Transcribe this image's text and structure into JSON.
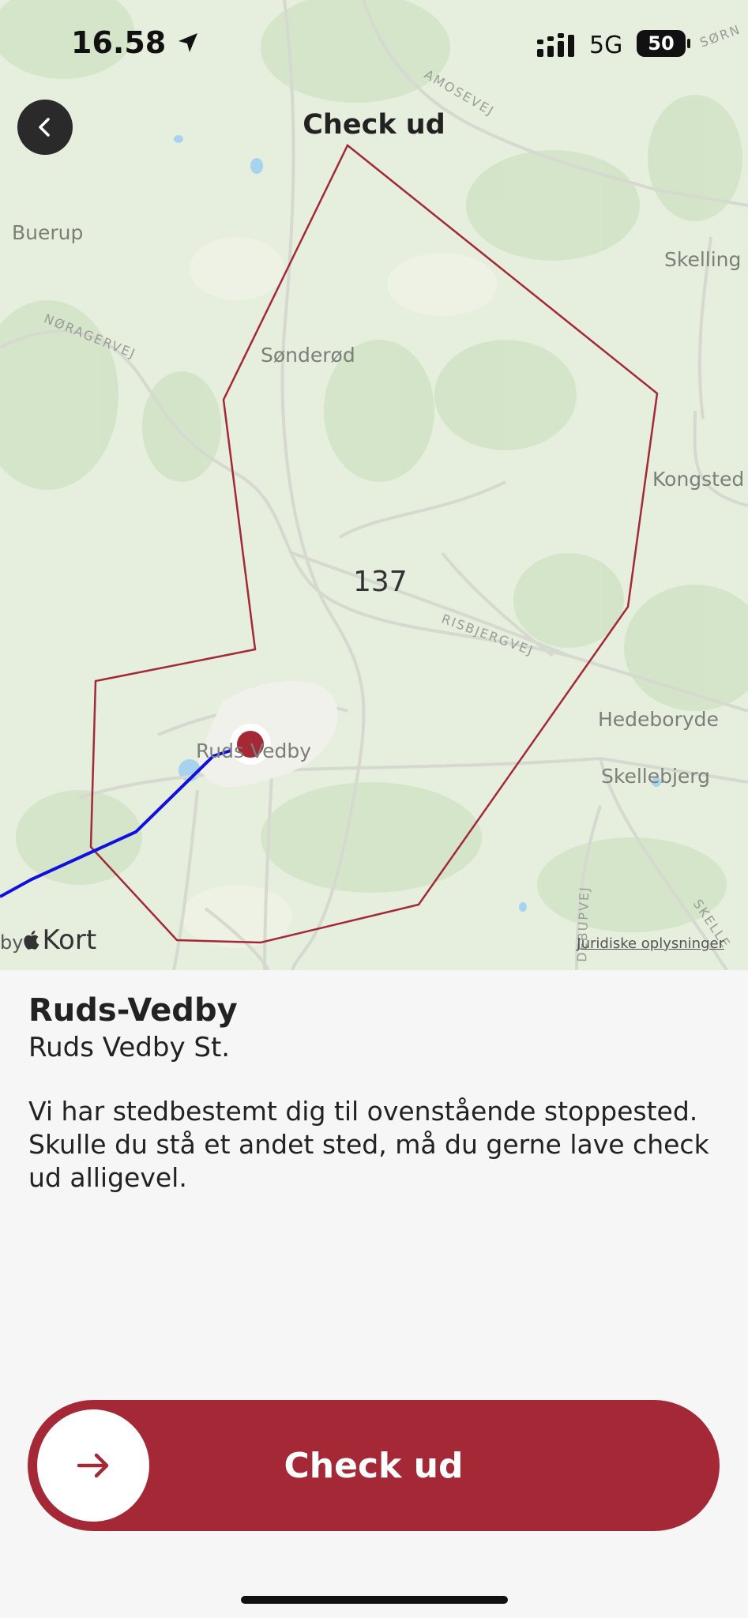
{
  "status_bar": {
    "time": "16.58",
    "network": "5G",
    "battery": "50"
  },
  "header": {
    "title": "Check ud"
  },
  "map": {
    "zone_number": "137",
    "places": [
      "Buerup",
      "Sønderød",
      "Skelling",
      "Kongsted",
      "Hedeboryde",
      "Skellebjerg",
      "Ruds Vedby"
    ],
    "roads": [
      "AMOSEVEJ",
      "NØRAGERVEJ",
      "RISBJERGVEJ",
      "SØRN",
      "DEBUPVEJ",
      "SKELLE"
    ],
    "attribution": "Kort",
    "legal_link": "Juridiske oplysninger",
    "colors": {
      "background": "#e6eedd",
      "zone_outline": "#a52837",
      "route": "#1010e0",
      "stop_marker": "#a52837"
    }
  },
  "stop": {
    "name": "Ruds-Vedby",
    "station": "Ruds Vedby St.",
    "description": "Vi har stedbestemt dig til ovenstående stoppested. Skulle du stå et andet sted, må du gerne lave check ud alligevel."
  },
  "action": {
    "label": "Check ud",
    "icon": "arrow-right-icon",
    "color": "#a52837"
  }
}
